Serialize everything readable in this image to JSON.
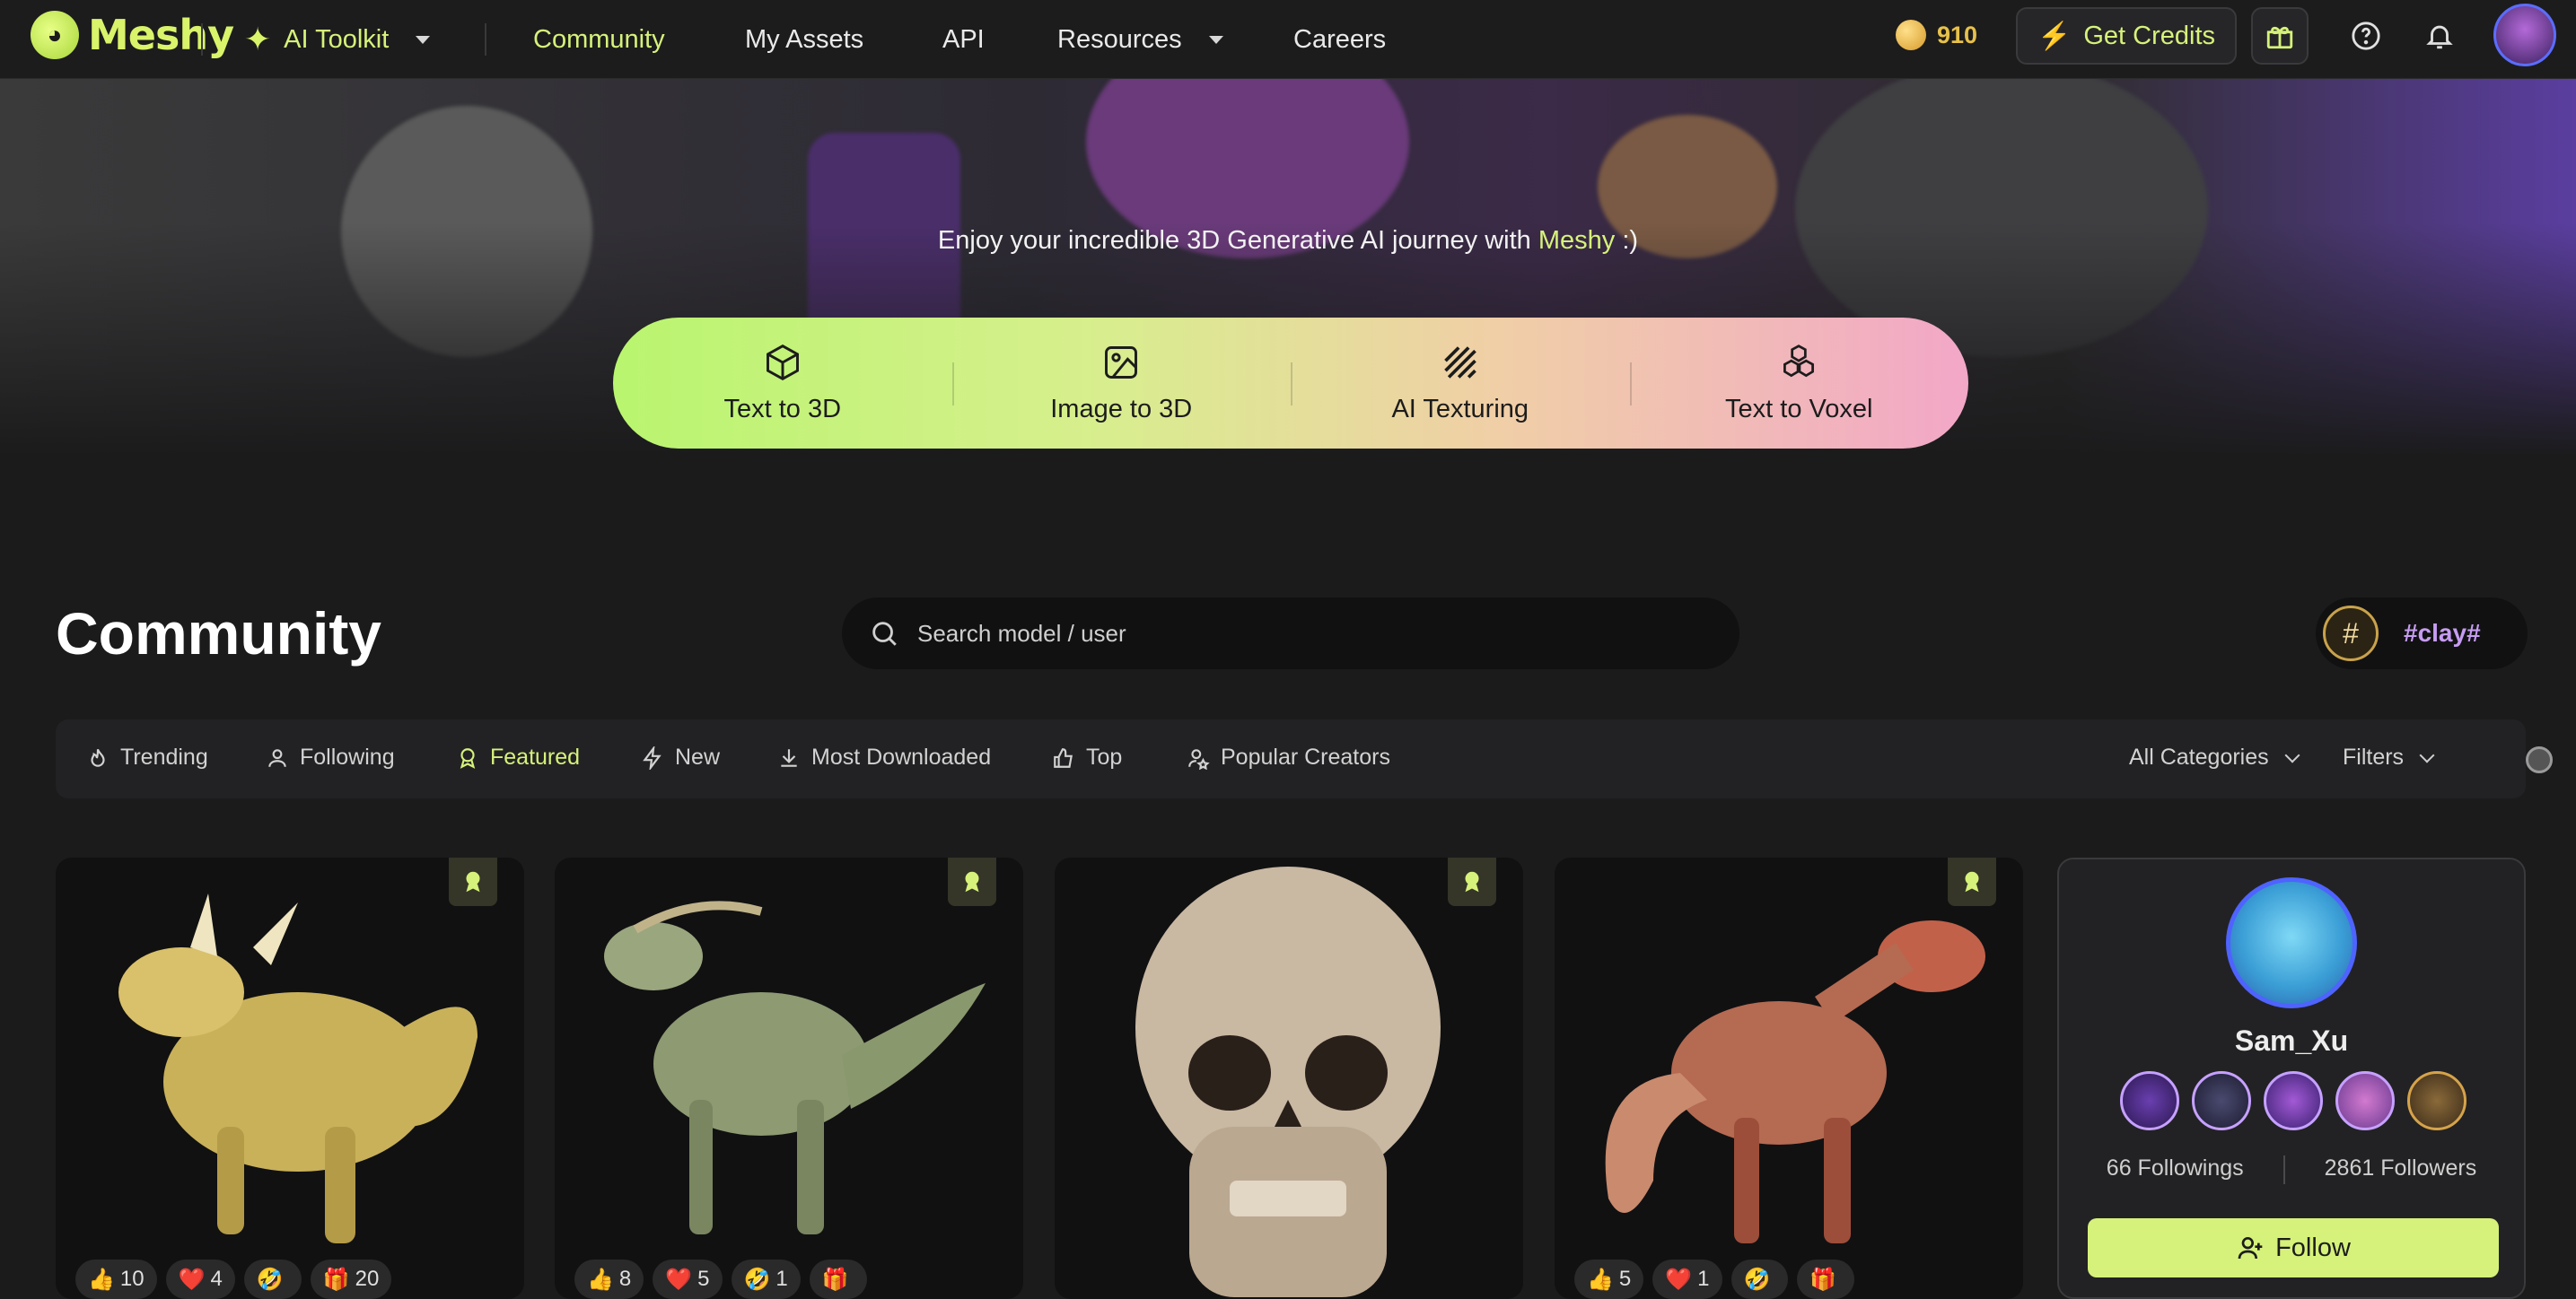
{
  "nav": {
    "logo": "Meshy",
    "ai_toolkit": "AI Toolkit",
    "community": "Community",
    "my_assets": "My Assets",
    "api": "API",
    "resources": "Resources",
    "careers": "Careers",
    "credits": "910",
    "get_credits": "Get Credits"
  },
  "hero": {
    "tagline_pre": "Enjoy your incredible 3D Generative AI journey with",
    "tagline_brand": "Meshy",
    "tagline_post": ":)",
    "tools": [
      {
        "label": "Text to 3D",
        "icon": "cube-icon"
      },
      {
        "label": "Image to 3D",
        "icon": "image-icon"
      },
      {
        "label": "AI Texturing",
        "icon": "texture-stripes-icon"
      },
      {
        "label": "Text to Voxel",
        "icon": "voxel-icon"
      }
    ]
  },
  "community": {
    "title": "Community",
    "search_placeholder": "Search model / user",
    "tag": "#clay#"
  },
  "filters": {
    "tabs": [
      "Trending",
      "Following",
      "Featured",
      "New",
      "Most Downloaded",
      "Top",
      "Popular Creators"
    ],
    "active_tab": "Featured",
    "categories": "All Categories",
    "filters": "Filters"
  },
  "cards": [
    {
      "subject": "yellow horned dinosaur",
      "likes": "10",
      "hearts": "4",
      "laugh": "",
      "gifts": "20"
    },
    {
      "subject": "green raptor dinosaur",
      "likes": "8",
      "hearts": "5",
      "laugh": "1",
      "gifts": ""
    },
    {
      "subject": "human skull",
      "likes": "",
      "hearts": "",
      "laugh": "",
      "gifts": ""
    },
    {
      "subject": "red horned raptor",
      "likes": "5",
      "hearts": "1",
      "laugh": "",
      "gifts": ""
    }
  ],
  "creator": {
    "name": "Sam_Xu",
    "followings": "66 Followings",
    "followers": "2861 Followers",
    "follow": "Follow"
  },
  "colors": {
    "accent": "#d6f27a",
    "background": "#1b1b1c",
    "credits": "#e7c14a"
  }
}
